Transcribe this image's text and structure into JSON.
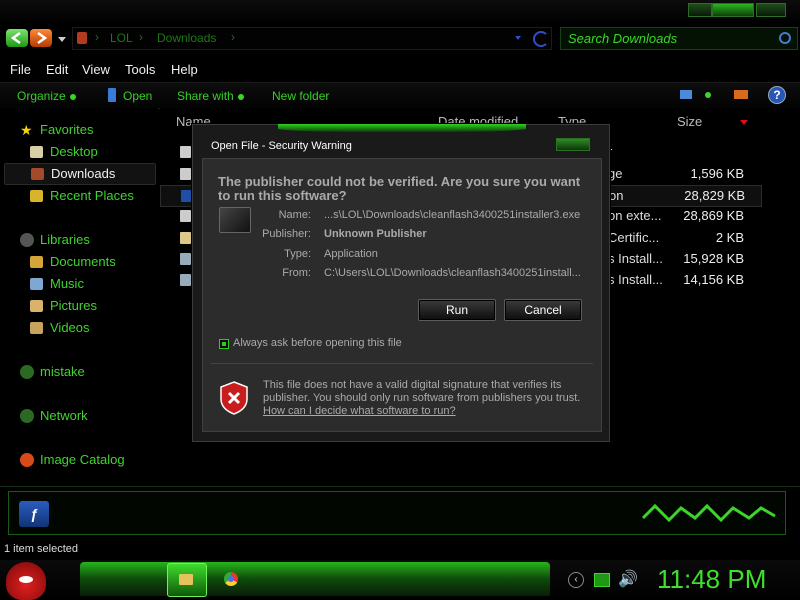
{
  "address": {
    "path": [
      "LOL",
      "Downloads"
    ]
  },
  "search": {
    "placeholder": "Search Downloads"
  },
  "menu": [
    "File",
    "Edit",
    "View",
    "Tools",
    "Help"
  ],
  "commands": {
    "organize": "Organize",
    "open": "Open",
    "share_with": "Share with",
    "new_folder": "New folder"
  },
  "nav": {
    "favorites": "Favorites",
    "favorites_items": [
      "Desktop",
      "Downloads",
      "Recent Places"
    ],
    "libraries": "Libraries",
    "libraries_items": [
      "Documents",
      "Music",
      "Pictures",
      "Videos"
    ],
    "mistake": "mistake",
    "network": "Network",
    "image_catalog": "Image Catalog"
  },
  "columns": {
    "name": "Name",
    "date_modified": "Date modified",
    "type": "Type",
    "size": "Size"
  },
  "files": [
    {
      "type": "r",
      "size": ""
    },
    {
      "type": "ge",
      "size": "1,596 KB"
    },
    {
      "type": "on",
      "size": "28,829 KB"
    },
    {
      "type": "on exte...",
      "size": "28,869 KB"
    },
    {
      "type": "Certific...",
      "size": "2 KB"
    },
    {
      "type": "s Install...",
      "size": "15,928 KB"
    },
    {
      "type": "s Install...",
      "size": "14,156 KB"
    }
  ],
  "status": {
    "text": "1 item selected"
  },
  "taskbar": {
    "clock": "11:48 PM"
  },
  "dialog": {
    "title": "Open File - Security Warning",
    "question": "The publisher could not be verified.  Are you sure you want to run this software?",
    "fields": [
      {
        "key": "Name:",
        "value": "...s\\LOL\\Downloads\\cleanflash3400251installer3.exe"
      },
      {
        "key": "Publisher:",
        "value": "Unknown Publisher"
      },
      {
        "key": "Type:",
        "value": "Application"
      },
      {
        "key": "From:",
        "value": "C:\\Users\\LOL\\Downloads\\cleanflash3400251install..."
      }
    ],
    "run_label": "Run",
    "cancel_label": "Cancel",
    "checkbox_label": "Always ask before opening this file",
    "checkbox_checked": true,
    "warning": "This file does not have a valid digital signature that verifies its publisher.  You should only run software from publishers you trust.",
    "link": "How can I decide what software to run?"
  },
  "colors": {
    "accent": "#3cd52a",
    "background": "#000000",
    "dialog_body": "#2c2c2c"
  },
  "icons": [
    "back-arrow-icon",
    "forward-arrow-icon",
    "refresh-icon",
    "search-icon",
    "help-icon",
    "star-icon",
    "folder-icon",
    "shield-error-icon",
    "flash-icon",
    "angry-bird-icon",
    "chrome-icon",
    "volume-icon"
  ]
}
